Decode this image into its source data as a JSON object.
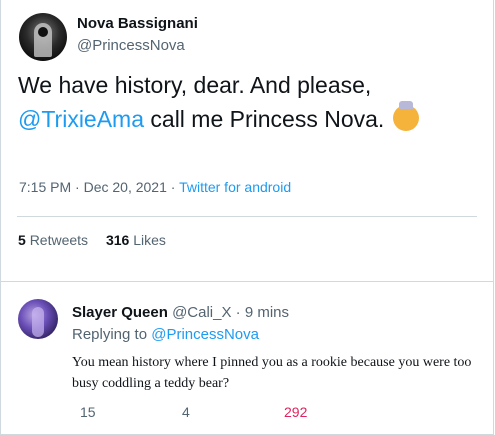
{
  "tweet": {
    "author_name": "Nova Bassignani",
    "author_handle": "@PrincessNova",
    "text_part1": "We have history, dear. And please,",
    "mention": "@TrixieAma",
    "text_part2": " call me Princess Nova.",
    "emoji": "princess-emoji",
    "timestamp": "7:15 PM · Dec 20, 2021 · ",
    "source": "Twitter for android",
    "retweets_count": "5",
    "retweets_label": "Retweets",
    "likes_count": "316",
    "likes_label": "Likes"
  },
  "reply": {
    "author_name": "Slayer Queen",
    "author_handle": "@Cali_X",
    "time": "· 9 mins",
    "replying_label": "Replying to ",
    "replying_to": "@PrincessNova",
    "text": "You mean history where I pinned you as a rookie because you were too busy coddling a teddy bear?",
    "replies_count": "15",
    "retweets_count": "4",
    "likes_count": "292"
  },
  "colors": {
    "accent": "#1d9bf0",
    "like": "#e0245e",
    "muted": "#536471"
  }
}
